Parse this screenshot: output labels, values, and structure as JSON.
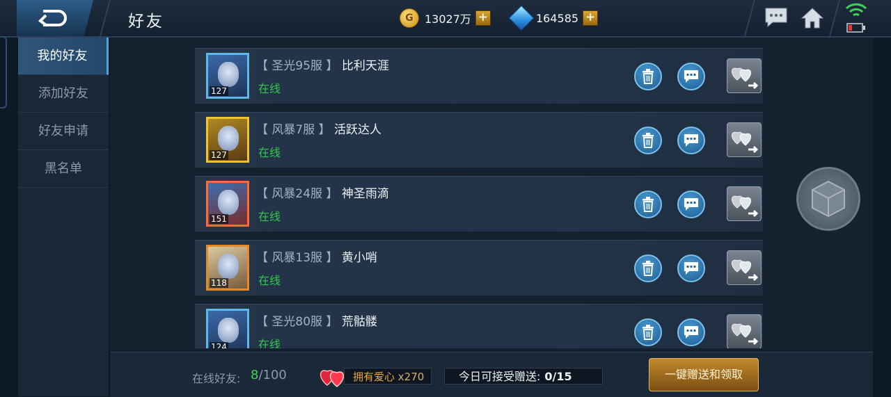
{
  "header": {
    "title": "好友",
    "gold": {
      "value": "13027万",
      "icon": "gold-coin-icon",
      "plus": "+"
    },
    "gems": {
      "value": "164585",
      "icon": "diamond-icon",
      "plus": "+"
    },
    "icons": [
      "chat-icon",
      "home-icon",
      "wifi-icon",
      "battery-icon"
    ]
  },
  "sidebar": {
    "items": [
      {
        "label": "我的好友",
        "active": true
      },
      {
        "label": "添加好友",
        "active": false
      },
      {
        "label": "好友申请",
        "active": false
      },
      {
        "label": "黑名单",
        "active": false
      }
    ]
  },
  "friends": [
    {
      "server": "【 圣光95服 】",
      "name": "比利天涯",
      "status": "在线",
      "level": "127",
      "frame": "blue"
    },
    {
      "server": "【 风暴7服 】",
      "name": "活跃达人",
      "status": "在线",
      "level": "127",
      "frame": "gold"
    },
    {
      "server": "【 风暴24服 】",
      "name": "神圣雨滴",
      "status": "在线",
      "level": "151",
      "frame": "red"
    },
    {
      "server": "【 风暴13服 】",
      "name": "黄小哨",
      "status": "在线",
      "level": "118",
      "frame": "orange"
    },
    {
      "server": "【 圣光80服 】",
      "name": "荒骷髅",
      "status": "在线",
      "level": "124",
      "frame": "blue"
    }
  ],
  "footer": {
    "online_label": "在线好友:",
    "online_count": "8",
    "online_total": "/100",
    "love_label": "拥有爱心",
    "love_count": "x270",
    "receive_label": "今日可接受赠送:",
    "receive_value": "0/15",
    "action_button": "一键赠送和领取"
  },
  "colors": {
    "online": "#32c74e",
    "accent": "#4fa3e0",
    "gold": "#e9a83e"
  }
}
